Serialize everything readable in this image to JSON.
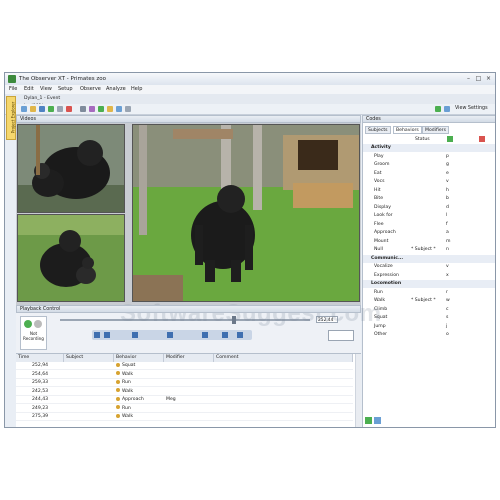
{
  "app": {
    "title": "The Observer XT - Primates zoo"
  },
  "menu": [
    "File",
    "Edit",
    "View",
    "Setup",
    "Observe",
    "Analyze",
    "Help"
  ],
  "document_tab": "Dylan_1 - Event log(001)",
  "toolbar": {
    "view_settings": "View Settings"
  },
  "side_tab": "Project Explorer",
  "videos": {
    "header": "Videos"
  },
  "playback": {
    "header": "Playback Control",
    "recording_status": "Not\nRecording",
    "time": "252,44"
  },
  "log": {
    "columns": [
      "Time",
      "Subject",
      "Behavior",
      "Modifier",
      "Comment"
    ],
    "rows": [
      {
        "time": "252,94",
        "subject": "",
        "behavior": "Squat",
        "modifier": "",
        "comment": ""
      },
      {
        "time": "254,64",
        "subject": "",
        "behavior": "Walk",
        "modifier": "",
        "comment": ""
      },
      {
        "time": "259,33",
        "subject": "",
        "behavior": "Run",
        "modifier": "",
        "comment": ""
      },
      {
        "time": "242,53",
        "subject": "",
        "behavior": "Walk",
        "modifier": "",
        "comment": ""
      },
      {
        "time": "244,43",
        "subject": "",
        "behavior": "Approach",
        "modifier": "Meg",
        "comment": ""
      },
      {
        "time": "249,23",
        "subject": "",
        "behavior": "Run",
        "modifier": "",
        "comment": ""
      },
      {
        "time": "275,39",
        "subject": "",
        "behavior": "Walk",
        "modifier": "",
        "comment": ""
      }
    ]
  },
  "codes": {
    "header": "Codes",
    "tabs": [
      "Subjects",
      "Behaviors",
      "Modifiers"
    ],
    "status_col": "Status",
    "groups": [
      {
        "name": "Activity",
        "items": [
          {
            "name": "Play",
            "subject": "",
            "key": "p"
          },
          {
            "name": "Groom",
            "subject": "",
            "key": "g"
          },
          {
            "name": "Eat",
            "subject": "",
            "key": "e"
          },
          {
            "name": "Vocs",
            "subject": "",
            "key": "v"
          },
          {
            "name": "Hit",
            "subject": "",
            "key": "h"
          },
          {
            "name": "Bite",
            "subject": "",
            "key": "b"
          },
          {
            "name": "Display",
            "subject": "",
            "key": "d"
          },
          {
            "name": "Look for",
            "subject": "",
            "key": "l"
          },
          {
            "name": "Flee",
            "subject": "",
            "key": "f"
          },
          {
            "name": "Approach",
            "subject": "",
            "key": "a"
          },
          {
            "name": "Mount",
            "subject": "",
            "key": "m"
          },
          {
            "name": "Null",
            "subject": "* Subject *",
            "key": "n"
          }
        ]
      },
      {
        "name": "Communic...",
        "items": [
          {
            "name": "Vocalize",
            "subject": "",
            "key": "v"
          },
          {
            "name": "Expression",
            "subject": "",
            "key": "x"
          }
        ]
      },
      {
        "name": "Locomotion",
        "items": [
          {
            "name": "Run",
            "subject": "",
            "key": "r"
          },
          {
            "name": "Walk",
            "subject": "* Subject *",
            "key": "w"
          },
          {
            "name": "Climb",
            "subject": "",
            "key": "c"
          },
          {
            "name": "Squat",
            "subject": "",
            "key": "s"
          },
          {
            "name": "Jump",
            "subject": "",
            "key": "j"
          },
          {
            "name": "Other",
            "subject": "",
            "key": "o"
          }
        ]
      }
    ]
  },
  "watermark": "SoftwareSuggest.com",
  "colors": {
    "accent": "#3c8a3c",
    "recording": "#4caf50",
    "group_bg": "#e8edf5"
  }
}
